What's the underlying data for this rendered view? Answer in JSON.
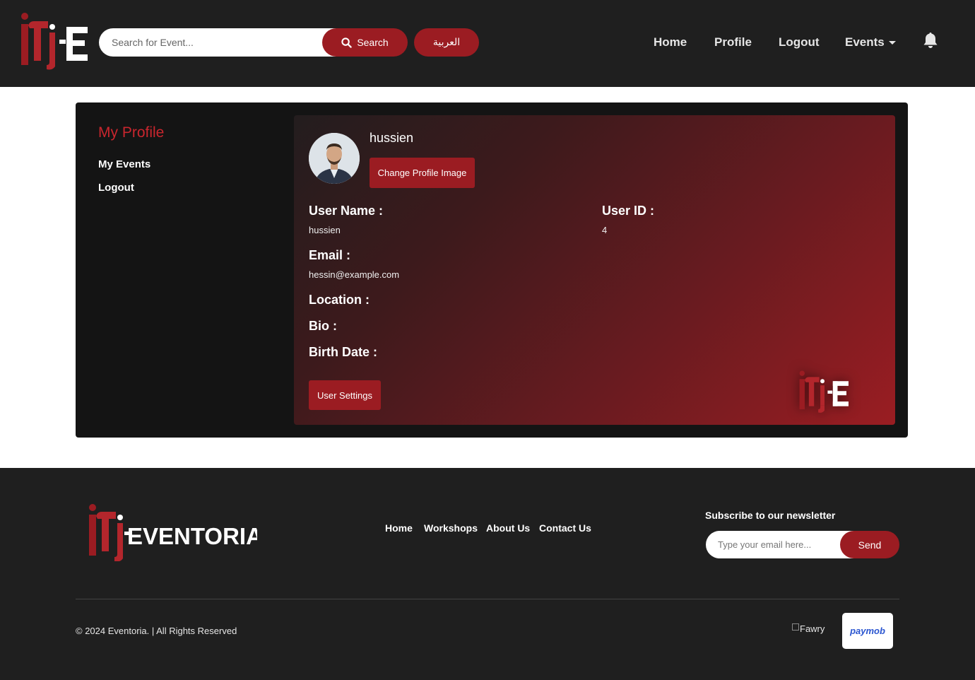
{
  "header": {
    "search": {
      "placeholder": "Search for Event...",
      "button_label": "Search"
    },
    "language_button": "العربية",
    "nav": [
      {
        "label": "Home"
      },
      {
        "label": "Profile"
      },
      {
        "label": "Logout"
      },
      {
        "label": "Events"
      }
    ],
    "icons": {
      "search": "search-icon",
      "notifications": "bell-icon",
      "dropdown": "caret-down-icon"
    }
  },
  "sidebar": {
    "title": "My Profile",
    "links": [
      {
        "label": "My Events"
      },
      {
        "label": "Logout"
      }
    ]
  },
  "profile": {
    "display_name": "hussien",
    "change_image_button": "Change Profile Image",
    "fields": {
      "user_name": {
        "label": "User Name :",
        "value": "hussien"
      },
      "user_id": {
        "label": "User ID :",
        "value": "4"
      },
      "email": {
        "label": "Email :",
        "value": "hessin@example.com"
      },
      "location": {
        "label": "Location :",
        "value": ""
      },
      "bio": {
        "label": "Bio :",
        "value": ""
      },
      "birth_date": {
        "label": "Birth Date :",
        "value": ""
      }
    },
    "settings_button": "User Settings"
  },
  "footer": {
    "brand": "EVENTORIA",
    "nav": [
      {
        "label": "Home"
      },
      {
        "label": "Workshops"
      },
      {
        "label": "About Us"
      },
      {
        "label": "Contact Us"
      }
    ],
    "newsletter": {
      "title": "Subscribe to our newsletter",
      "placeholder": "Type your email here...",
      "button_label": "Send"
    },
    "copyright": "© 2024 Eventoria. | All Rights Reserved",
    "payments": {
      "fawry_alt": "Fawry",
      "paymob": "paymob"
    }
  },
  "colors": {
    "accent": "#9b1c22",
    "accent_text": "#c9262e",
    "navbar_bg": "#1f1f1f",
    "card_bg": "#141414"
  }
}
